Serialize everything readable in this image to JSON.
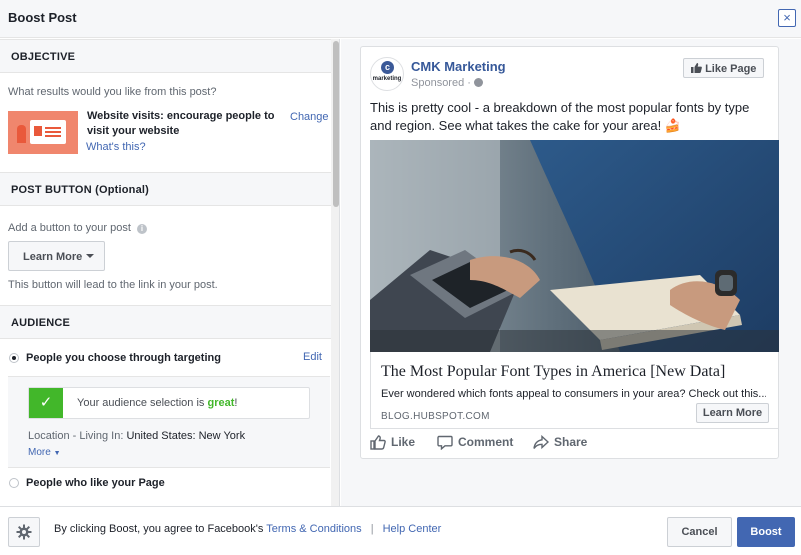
{
  "header": {
    "title": "Boost Post",
    "close_label": "×"
  },
  "objective": {
    "heading": "OBJECTIVE",
    "question": "What results would you like from this post?",
    "selection_line1": "Website visits: encourage people to",
    "selection_line2": "visit your website",
    "change_link": "Change",
    "whats_this_link": "What's this?"
  },
  "post_button": {
    "heading": "POST BUTTON (Optional)",
    "prompt": "Add a button to your post",
    "selected": "Learn More",
    "hint": "This button will lead to the link in your post."
  },
  "audience": {
    "heading": "AUDIENCE",
    "option1": "People you choose through targeting",
    "edit_link": "Edit",
    "status_prefix": "Your audience selection is",
    "status_value": "great",
    "status_suffix": "!",
    "location_label": "Location - Living In:",
    "location_value": "United States: New York",
    "more_link": "More",
    "option2": "People who like your Page"
  },
  "preview": {
    "page_name": "CMK Marketing",
    "avatar_letter": "c",
    "avatar_text": "marketing",
    "sponsored": "Sponsored ·",
    "like_page_button": "Like Page",
    "post_text": "This is pretty cool - a breakdown of the most popular fonts by type and region. See what takes the cake for your area! 🍰",
    "link_title": "The Most Popular Font Types in America [New Data]",
    "link_description": "Ever wondered which fonts appeal to consumers in your area? Check out this...",
    "link_domain": "BLOG.HUBSPOT.COM",
    "cta_button": "Learn More",
    "actions": {
      "like": "Like",
      "comment": "Comment",
      "share": "Share"
    }
  },
  "footer": {
    "agreement_prefix": "By clicking Boost, you agree to Facebook's",
    "terms_link": "Terms & Conditions",
    "separator": "|",
    "help_link": "Help Center",
    "cancel_button": "Cancel",
    "boost_button": "Boost"
  },
  "colors": {
    "brand": "#4267b2",
    "success": "#42b72a",
    "objective_thumb": "#f0866d"
  }
}
